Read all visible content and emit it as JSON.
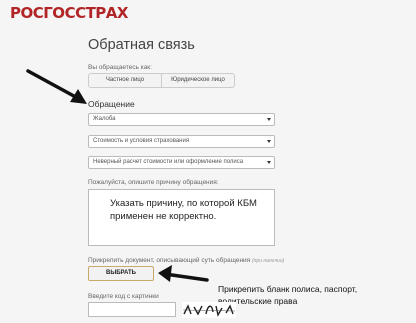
{
  "brand": {
    "logo_text": "РОСГОССТРАХ",
    "color": "#b22526"
  },
  "page": {
    "title": "Обратная связь"
  },
  "applicant": {
    "label": "Вы обращаетесь как:",
    "options": [
      "Частное лицо",
      "Юридическое лицо"
    ]
  },
  "appeal": {
    "section_title": "Обращение",
    "selects": [
      {
        "value": "Жалоба"
      },
      {
        "value": "Стоимость и условия страхования"
      },
      {
        "value": "Неверный расчет стоимости или оформление полиса"
      }
    ],
    "description_label": "Пожалуйста, опишите причину обращения:",
    "description_value": "Указать причину, по которой КБМ\nприменен не корректно."
  },
  "attachment": {
    "label": "Прикрепить документ, описывающий суть обращения",
    "hint": "(при наличии)",
    "button_label": "ВЫБРАТЬ"
  },
  "annotation": {
    "note": "Прикрепить бланк полиса, паспорт,\nводительские права"
  },
  "captcha": {
    "label": "Введите код с картинки",
    "input_value": "",
    "image_text": "7Ь"
  },
  "colors": {
    "accent_border": "#c9a86b",
    "background": "#f5f5f5"
  }
}
